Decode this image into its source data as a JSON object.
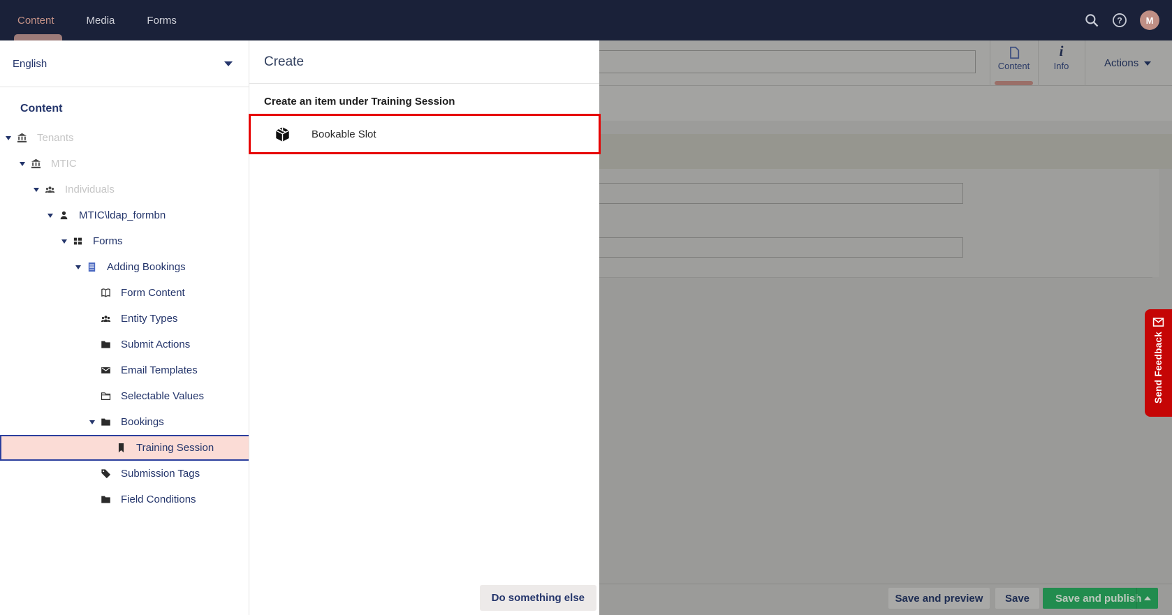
{
  "topbar": {
    "tabs": [
      {
        "label": "Content",
        "active": true
      },
      {
        "label": "Media",
        "active": false
      },
      {
        "label": "Forms",
        "active": false
      }
    ],
    "icons": [
      "search",
      "help"
    ],
    "avatar_initial": "M"
  },
  "sidebar": {
    "language_selector": {
      "value": "English",
      "icon": "chevron-down"
    },
    "section_title": "Content",
    "tree": [
      {
        "label": "Tenants",
        "level": 0,
        "icon": "bank",
        "caret": true,
        "disabled": true,
        "selected": false
      },
      {
        "label": "MTIC",
        "level": 1,
        "icon": "bank",
        "caret": true,
        "disabled": true,
        "selected": false
      },
      {
        "label": "Individuals",
        "level": 2,
        "icon": "users",
        "caret": true,
        "disabled": true,
        "selected": false
      },
      {
        "label": "MTIC\\ldap_formbn",
        "level": 3,
        "icon": "user",
        "caret": true,
        "disabled": false,
        "selected": false
      },
      {
        "label": "Forms",
        "level": 4,
        "icon": "grid",
        "caret": true,
        "disabled": false,
        "selected": false
      },
      {
        "label": "Adding Bookings",
        "level": 5,
        "icon": "doc-lines",
        "caret": true,
        "disabled": false,
        "selected": false
      },
      {
        "label": "Form Content",
        "level": 6,
        "icon": "book",
        "caret": false,
        "disabled": false,
        "selected": false
      },
      {
        "label": "Entity Types",
        "level": 6,
        "icon": "users",
        "caret": false,
        "disabled": false,
        "selected": false
      },
      {
        "label": "Submit Actions",
        "level": 6,
        "icon": "folder",
        "caret": false,
        "disabled": false,
        "selected": false
      },
      {
        "label": "Email Templates",
        "level": 6,
        "icon": "email",
        "caret": false,
        "disabled": false,
        "selected": false
      },
      {
        "label": "Selectable Values",
        "level": 6,
        "icon": "folder-open",
        "caret": false,
        "disabled": false,
        "selected": false
      },
      {
        "label": "Bookings",
        "level": 6,
        "icon": "folder",
        "caret": true,
        "disabled": false,
        "selected": false
      },
      {
        "label": "Training Session",
        "level": 7,
        "icon": "bookmark",
        "caret": false,
        "disabled": false,
        "selected": true
      },
      {
        "label": "Submission Tags",
        "level": 6,
        "icon": "tag",
        "caret": false,
        "disabled": false,
        "selected": false
      },
      {
        "label": "Field Conditions",
        "level": 6,
        "icon": "folder",
        "caret": false,
        "disabled": false,
        "selected": false
      }
    ]
  },
  "create_dialog": {
    "title": "Create",
    "heading": "Create an item under Training Session",
    "items": [
      {
        "label": "Bookable Slot",
        "icon": "package",
        "highlighted": true
      }
    ],
    "footer_button": "Do something else"
  },
  "workspace": {
    "name_input": {
      "value": ""
    },
    "tabs": [
      {
        "label": "Content",
        "icon": "document",
        "active": true
      },
      {
        "label": "Info",
        "icon": "info",
        "active": false
      }
    ],
    "actions_button": "Actions",
    "footer_buttons": [
      {
        "label": "Save and preview",
        "primary": false
      },
      {
        "label": "Save",
        "primary": false
      },
      {
        "label": "Save and publish",
        "primary": true,
        "split_caret": true
      }
    ]
  },
  "feedback_tab": {
    "label": "Send Feedback",
    "icon": "envelope"
  },
  "colors": {
    "topbar_bg": "#1a2139",
    "topbar_active_pill": "#9d7b79",
    "topbar_active_text": "#c59287",
    "tree_text": "#24356b",
    "tree_disabled_text": "#c6c6c6",
    "selected_row_bg": "#fbdcd6",
    "selected_row_border": "#2b3f9e",
    "annotation_red": "#e60000",
    "feedback_red": "#c50505",
    "publish_green": "#218c4e",
    "dimmed_overlay": "#9b9b99"
  }
}
